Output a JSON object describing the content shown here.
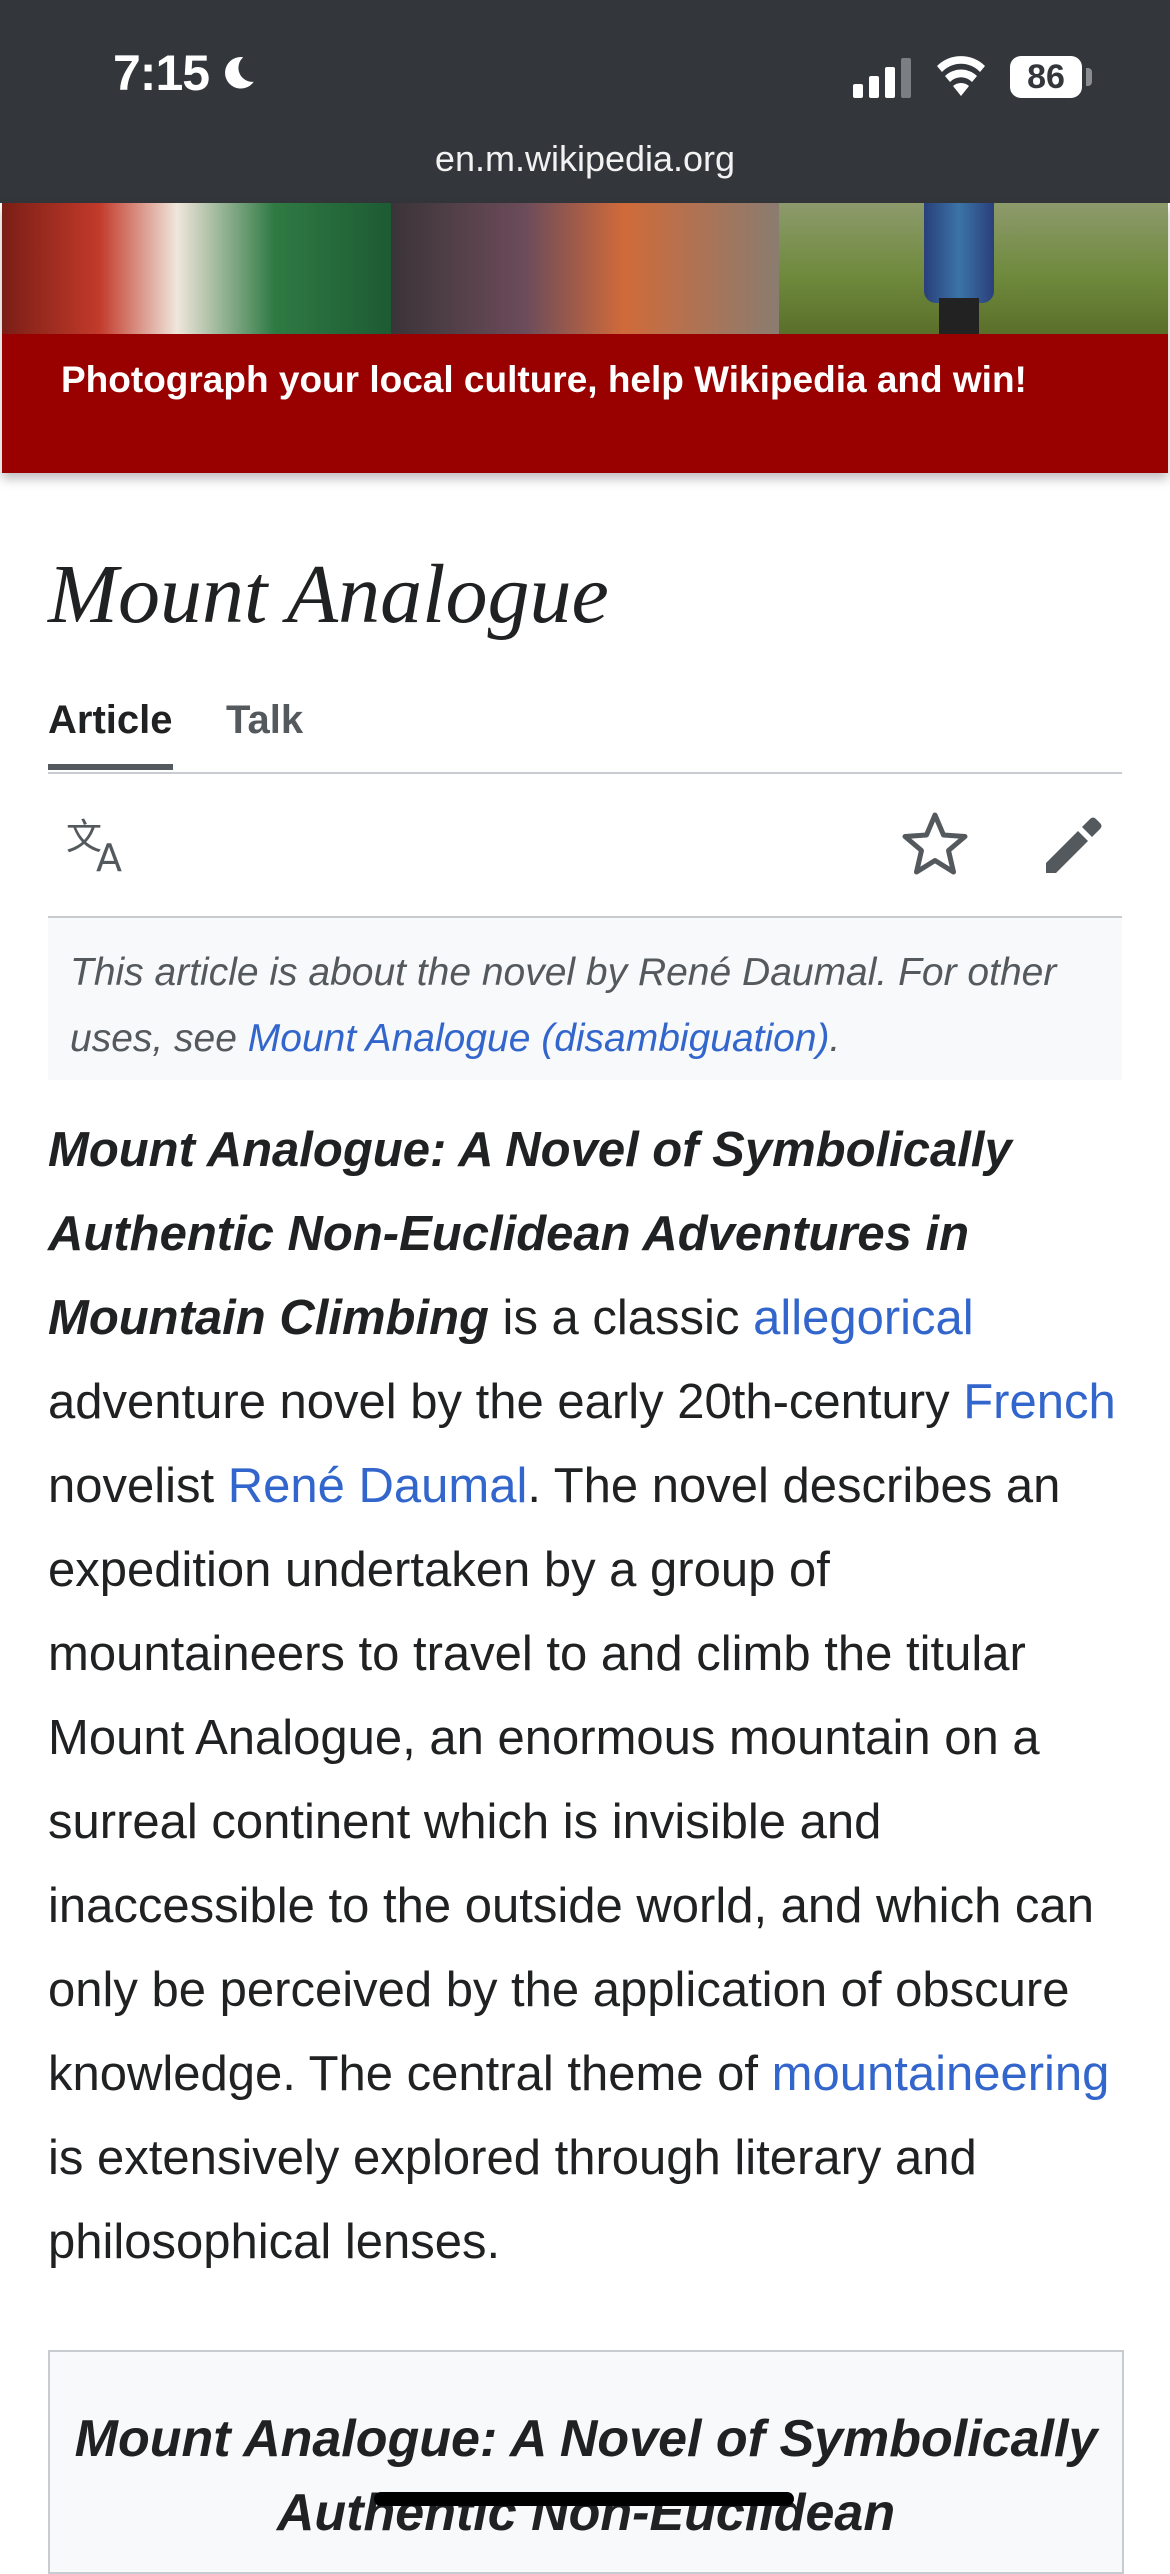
{
  "status_bar": {
    "time": "7:15",
    "battery": "86",
    "icons": [
      "moon-icon",
      "cellular-signal-icon",
      "wifi-icon",
      "battery-icon"
    ]
  },
  "browser": {
    "url": "en.m.wikipedia.org"
  },
  "banner": {
    "text": "Photograph your local culture, help Wikipedia and win!",
    "color": "#990000"
  },
  "article": {
    "title": "Mount Analogue",
    "tabs": [
      {
        "label": "Article",
        "active": true
      },
      {
        "label": "Talk",
        "active": false
      }
    ],
    "toolbar_icons": [
      "language-icon",
      "watch-star-icon",
      "edit-pencil-icon"
    ],
    "hatnote": {
      "prefix": "This article is about the novel by René Daumal. For other uses, see ",
      "link": "Mount Analogue (disambiguation)",
      "suffix": "."
    },
    "paragraph": {
      "bold_title": "Mount Analogue: A Novel of Symbolically Authentic Non-Euclidean Adventures in Mountain Climbing",
      "t1": " is a classic ",
      "link1": "allegorical",
      "t2": " adventure novel by the early 20th-century ",
      "link2": "French",
      "t3": " novelist ",
      "link3": "René Daumal",
      "t4": ". The novel describes an expedition undertaken by a group of mountaineers to travel to and climb the titular Mount Analogue, an enormous mountain on a surreal continent which is invisible and inaccessible to the outside world, and which can only be perceived by the application of obscure knowledge. The central theme of ",
      "link4": "mountaineering",
      "t5": " is extensively explored through literary and philosophical lenses."
    },
    "infobox_title": "Mount Analogue: A Novel of Symbolically Authentic Non-Euclidean"
  },
  "colors": {
    "link": "#3366cc",
    "text": "#202122",
    "status_bar": "#33363a"
  }
}
